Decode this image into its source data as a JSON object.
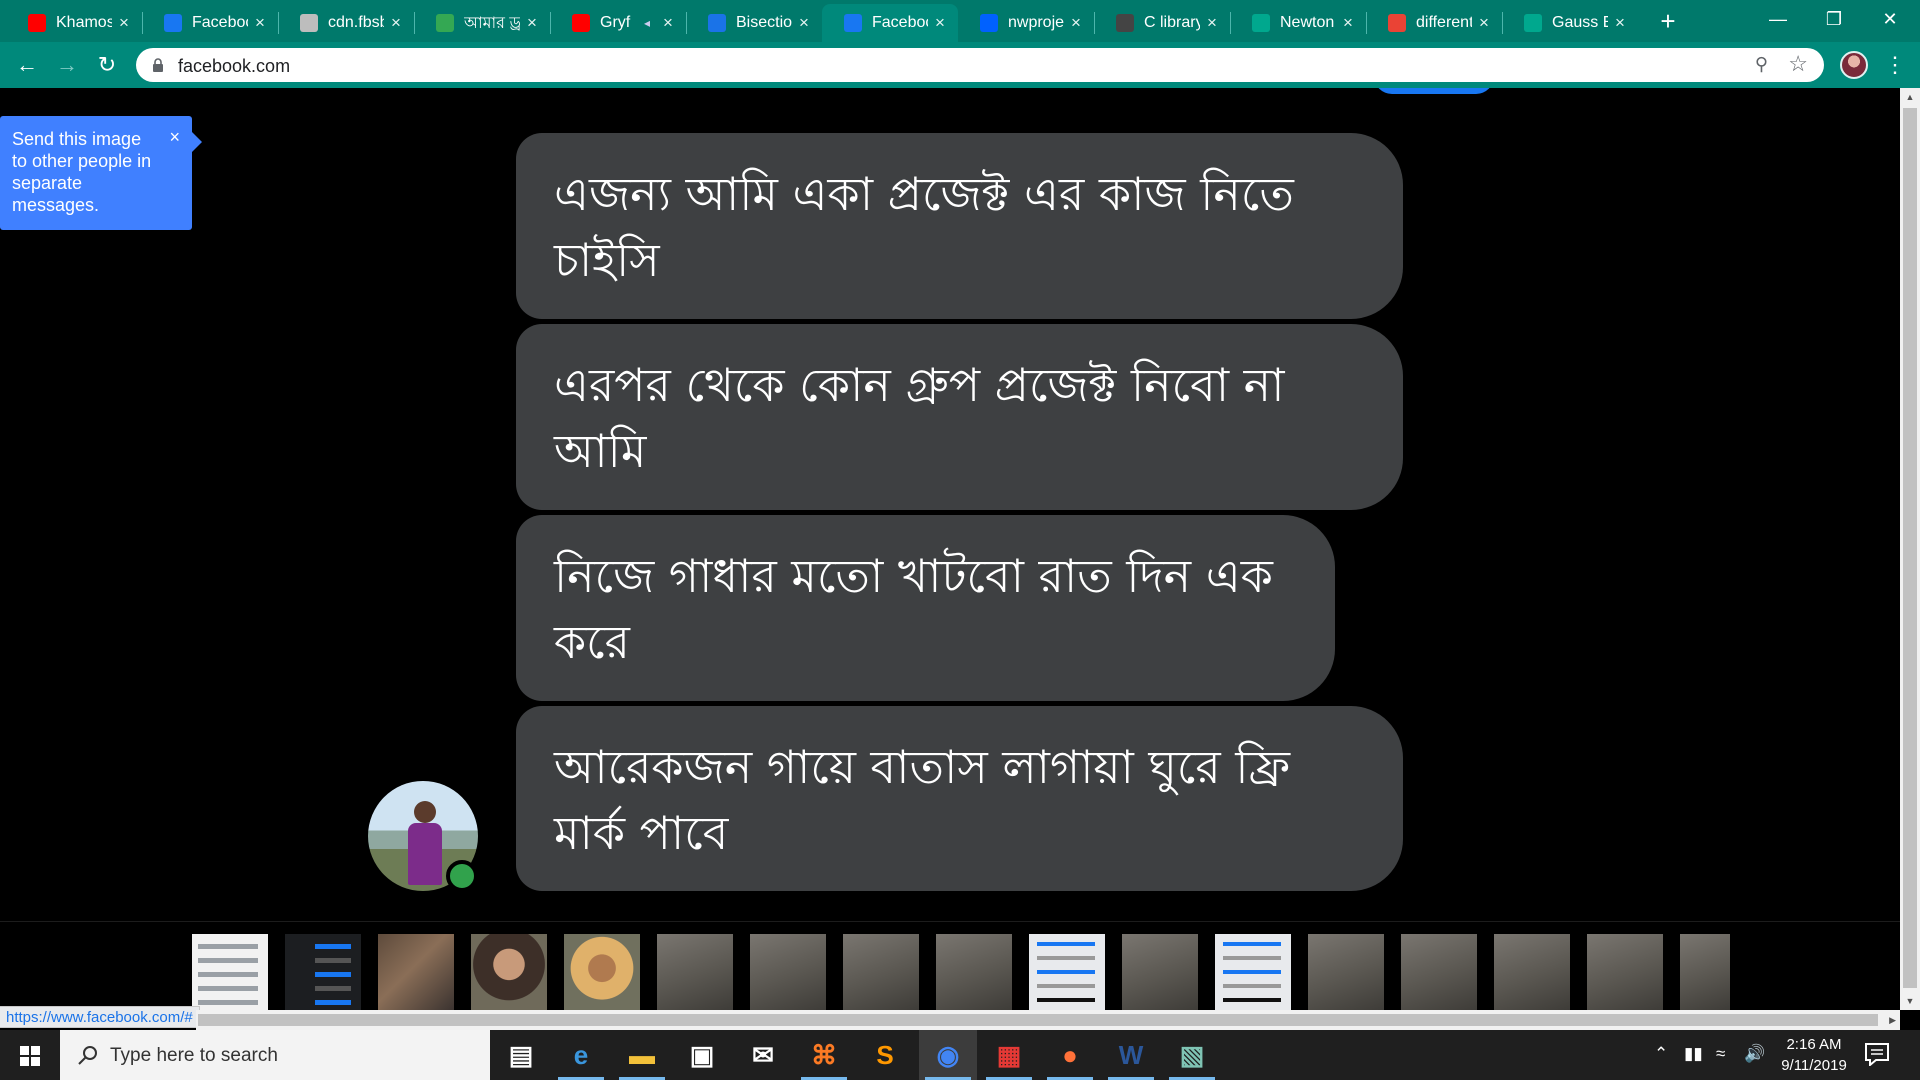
{
  "browser": {
    "tabs": [
      {
        "title": "Khamosh",
        "favicon": "youtube-icon",
        "color": "#ff0000"
      },
      {
        "title": "Facebook",
        "favicon": "facebook-icon",
        "color": "#1877f2"
      },
      {
        "title": "cdn.fbsb",
        "favicon": "globe-icon",
        "color": "#bdbdbd"
      },
      {
        "title": "আমার ড্রা",
        "favicon": "google-drive-icon",
        "color": "#34a853"
      },
      {
        "title": "Gryf",
        "favicon": "youtube-icon",
        "color": "#ff0000",
        "muted": true
      },
      {
        "title": "Bisection",
        "favicon": "docs-icon",
        "color": "#1a73e8"
      },
      {
        "title": "Facebook",
        "favicon": "facebook-icon",
        "color": "#1877f2",
        "active": true
      },
      {
        "title": "nwproject",
        "favicon": "dropbox-icon",
        "color": "#0061ff"
      },
      {
        "title": "C library",
        "favicon": "cplusplus-icon",
        "color": "#444444"
      },
      {
        "title": "Newton",
        "favicon": "chegg-c-icon",
        "color": "#00a88e"
      },
      {
        "title": "different",
        "favicon": "google-icon",
        "color": "#ea4335"
      },
      {
        "title": "Gauss El",
        "favicon": "chegg-c-icon",
        "color": "#00a88e"
      }
    ],
    "new_tab_label": "+",
    "url": "facebook.com",
    "accent": "#00897b",
    "tab_strip_color": "#00796b"
  },
  "viewer": {
    "tooltip": "Send this image to other people in separate messages.",
    "tooltip_close": "×",
    "messages": [
      "এজন্য আমি একা প্রজেক্ট এর কাজ নিতে চাইসি",
      "এরপর থেকে কোন গ্রুপ প্রজেক্ট নিবো না আমি",
      "নিজে গাধার মতো খাটবো রাত দিন এক করে",
      "আরেকজন গায়ে বাতাস লাগায়া ঘুরে ফ্রি মার্ক পাবে"
    ],
    "bubble_color": "#3e4042",
    "online_color": "#31a24c",
    "thumbnails": [
      "chat-light",
      "chat-dark",
      "photo",
      "face",
      "kid",
      "paper",
      "paper",
      "paper",
      "paper",
      "message-light",
      "paper",
      "message-light",
      "paper",
      "paper",
      "paper",
      "paper",
      "paper-narrow"
    ]
  },
  "statusbar": {
    "link": "https://www.facebook.com/#"
  },
  "taskbar": {
    "search_placeholder": "Type here to search",
    "time": "2:16 AM",
    "date": "9/11/2019",
    "apps": [
      "task-view-icon",
      "edge-icon",
      "file-explorer-icon",
      "store-icon",
      "mail-icon",
      "xampp-icon",
      "sublime-icon",
      "chrome-icon",
      "office-icon",
      "firefox-icon",
      "word-icon",
      "remote-app-icon"
    ]
  }
}
